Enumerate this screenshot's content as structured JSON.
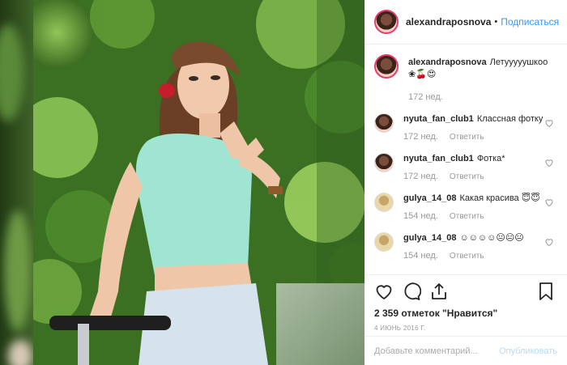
{
  "header": {
    "username": "alexandraposnova",
    "separator": "•",
    "follow_label": "Подписаться"
  },
  "caption": {
    "username": "alexandraposnova",
    "text": "Летууууушкоо ❀🍒😍",
    "time": "172 нед."
  },
  "comments": [
    {
      "username": "nyuta_fan_club1",
      "text": "Классная фотку",
      "time": "172 нед.",
      "reply": "Ответить"
    },
    {
      "username": "nyuta_fan_club1",
      "text": "Фотка*",
      "time": "172 нед.",
      "reply": "Ответить"
    },
    {
      "username": "gulya_14_08",
      "text": "Какая красива 😇😇",
      "time": "154 нед.",
      "reply": "Ответить"
    },
    {
      "username": "gulya_14_08",
      "text": "☺☺☺☺😐😐😐",
      "time": "154 нед.",
      "reply": "Ответить"
    }
  ],
  "actions": {
    "likes": "2 359 отметок \"Нравится\"",
    "date": "4 ИЮНЬ 2016 Г."
  },
  "add_comment": {
    "placeholder": "Добавьте комментарий...",
    "publish_label": "Опубликовать"
  },
  "icons": {
    "like": "heart-icon",
    "comment": "comment-icon",
    "share": "share-icon",
    "save": "bookmark-icon",
    "comment_like": "heart-outline-icon"
  },
  "colors": {
    "follow": "#3897f0",
    "publish_disabled": "#b3dbff",
    "avatar_ring": "#e63b6c"
  }
}
